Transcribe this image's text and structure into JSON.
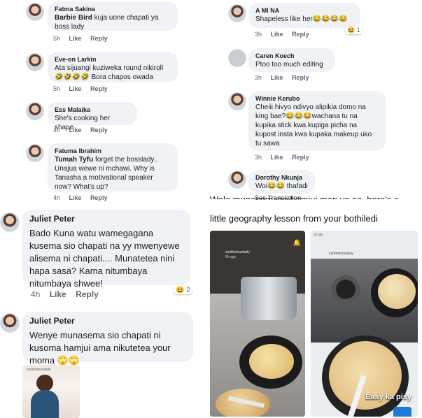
{
  "left_top_comments": [
    {
      "author": "Fatma Sakina",
      "tag": "Barbie Bird",
      "text": " kuja uone chapati ya boss lady",
      "time": "5h",
      "like": "Like",
      "reply": "Reply"
    },
    {
      "author": "Eve-on Larkin",
      "text": "Ata sijuangi kuziweka round nikiroll 🤣🤣🤣🤣 Bora chapos owada",
      "time": "5h",
      "like": "Like",
      "reply": "Reply"
    },
    {
      "author": "Ess Malaika",
      "text": "She's cooking her shape",
      "time": "4h",
      "like": "Like",
      "reply": "Reply"
    },
    {
      "author": "Fatuma Ibrahim",
      "tag": "Tumah Tyfu",
      "text": " forget the bosslady.. Unajua wewe ni mchawi. Why is Tanasha a motivational speaker now? What's up?",
      "time": "4h",
      "like": "Like",
      "reply": "Reply"
    }
  ],
  "right_comments": [
    {
      "author": "A MI NA",
      "text": "Shapeless like her😂😂😂😂",
      "time": "3h",
      "like": "Like",
      "reply": "Reply",
      "reaction": "😆 1"
    },
    {
      "author": "Caren Koech",
      "text": "Ptoo too much editing",
      "time": "3h",
      "like": "Like",
      "reply": "Reply"
    },
    {
      "author": "Winnie Kerubo",
      "text": "Cheiii hivyo ndivyo alipikia domo na king bae?😂😂😂wachana tu na kupika stick kwa kupiga picha na kupost insta kwa kupaka makeup uko tu sawa",
      "time": "3h",
      "like": "Like",
      "reply": "Reply"
    },
    {
      "author": "Dorothy Nkunja",
      "text": "Woi😂😂 thafadi",
      "see_translation": "See Translation"
    }
  ],
  "big_comments": [
    {
      "author": "Juliet Peter",
      "text": "Bado Kuna watu wamegagana kusema sio chapati na yy mwenyewe alisema ni chapati.... Munatetea nini hapa sasa? Kama nitumbaya nitumbaya shwee!",
      "time": "4h",
      "like": "Like",
      "reply": "Reply",
      "reaction": "😆 2"
    },
    {
      "author": "Juliet Peter",
      "text": "Wenye munasema sio chapati ni kusoma hamjui ama nikutetea your moma 🙄🙄"
    }
  ],
  "post": {
    "caption_partial": "Wale munasemaga hamjui map ya so, here's a",
    "caption": "little geography lesson from your bothiledi"
  },
  "stories": [
    {
      "user": "zarithebosslady",
      "time": "9h ago"
    },
    {
      "user": "zarithebosslady",
      "time": "07:29",
      "overlay": "Easy ka pisy"
    }
  ],
  "thumb_user": "zarithebosslady"
}
